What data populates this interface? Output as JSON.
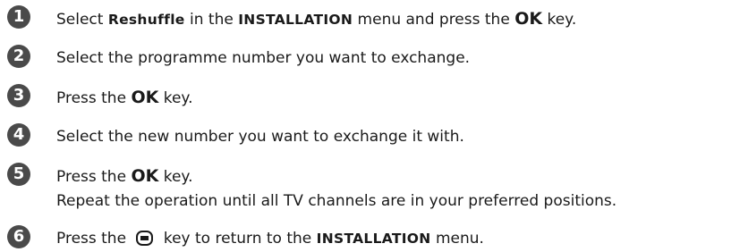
{
  "steps": [
    {
      "number": "1",
      "parts": [
        "Select ",
        "Reshuffle",
        " in the ",
        "INSTALLATION",
        " menu and press the ",
        "OK",
        " key."
      ]
    },
    {
      "number": "2",
      "text": "Select the programme number you want to exchange."
    },
    {
      "number": "3",
      "parts": [
        "Press the ",
        "OK",
        " key."
      ]
    },
    {
      "number": "4",
      "text": "Select the new number you want to exchange it with."
    },
    {
      "number": "5",
      "parts": [
        "Press the ",
        "OK",
        " key."
      ],
      "line2": "Repeat the operation until all TV channels are in your preferred positions."
    },
    {
      "number": "6",
      "parts": [
        "Press the ",
        " key to return to the ",
        "INSTALLATION",
        " menu."
      ],
      "icon": "menu-key-icon"
    }
  ]
}
